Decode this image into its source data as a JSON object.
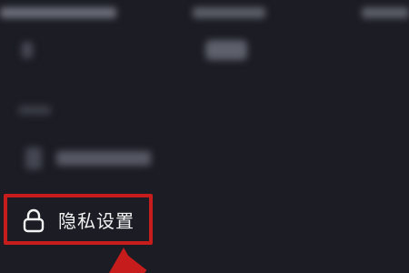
{
  "privacy_settings": {
    "label": "隐私设置",
    "icon": "lock-icon"
  },
  "colors": {
    "background": "#1b1c24",
    "highlight": "#c61c1c",
    "text": "#f2f2f2"
  }
}
